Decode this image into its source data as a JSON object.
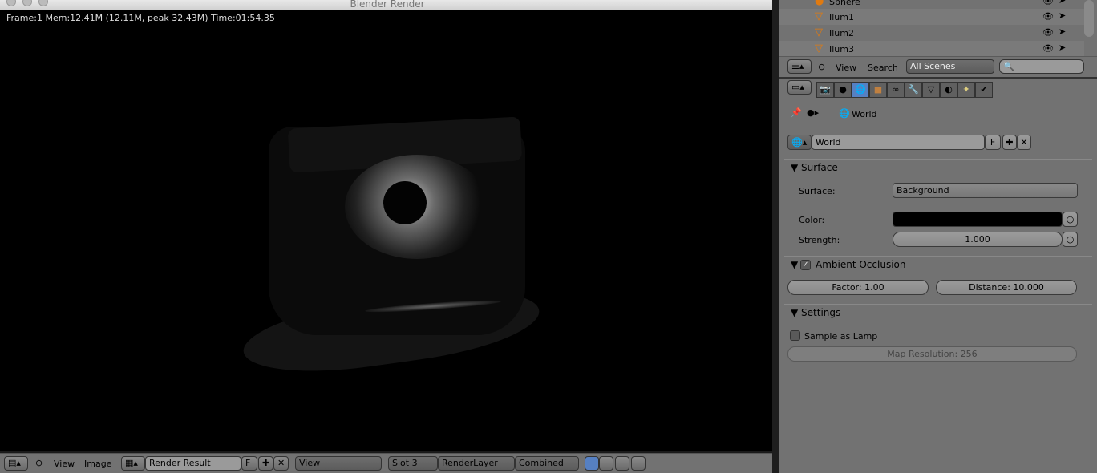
{
  "window": {
    "title": "Blender Render"
  },
  "render": {
    "info": "Frame:1 Mem:12.41M (12.11M, peak 32.43M) Time:01:54.35"
  },
  "image_header": {
    "menus": [
      "View",
      "Image"
    ],
    "image_name": "Render Result",
    "fake_user": "F",
    "view": "View",
    "slot": "Slot 3",
    "render_layer": "RenderLayer",
    "pass": "Combined"
  },
  "outliner": {
    "rows": [
      {
        "name": "Sphere"
      },
      {
        "name": "Ilum1"
      },
      {
        "name": "Ilum2"
      },
      {
        "name": "Ilum3"
      }
    ],
    "menus": [
      "View",
      "Search"
    ],
    "scene_filter": "All Scenes",
    "search_placeholder": ""
  },
  "properties": {
    "active_tab": "world",
    "breadcrumb": "World",
    "world_name": "World",
    "fake_user": "F",
    "surface": {
      "title": "Surface",
      "surface_label": "Surface:",
      "surface_value": "Background",
      "color_label": "Color:",
      "color": "#000000",
      "strength_label": "Strength:",
      "strength": "1.000"
    },
    "ao": {
      "title": "Ambient Occlusion",
      "enabled": true,
      "factor": "Factor: 1.00",
      "distance": "Distance: 10.000"
    },
    "settings": {
      "title": "Settings",
      "sample_as_lamp": "Sample as Lamp",
      "map_resolution": "Map Resolution: 256"
    }
  }
}
